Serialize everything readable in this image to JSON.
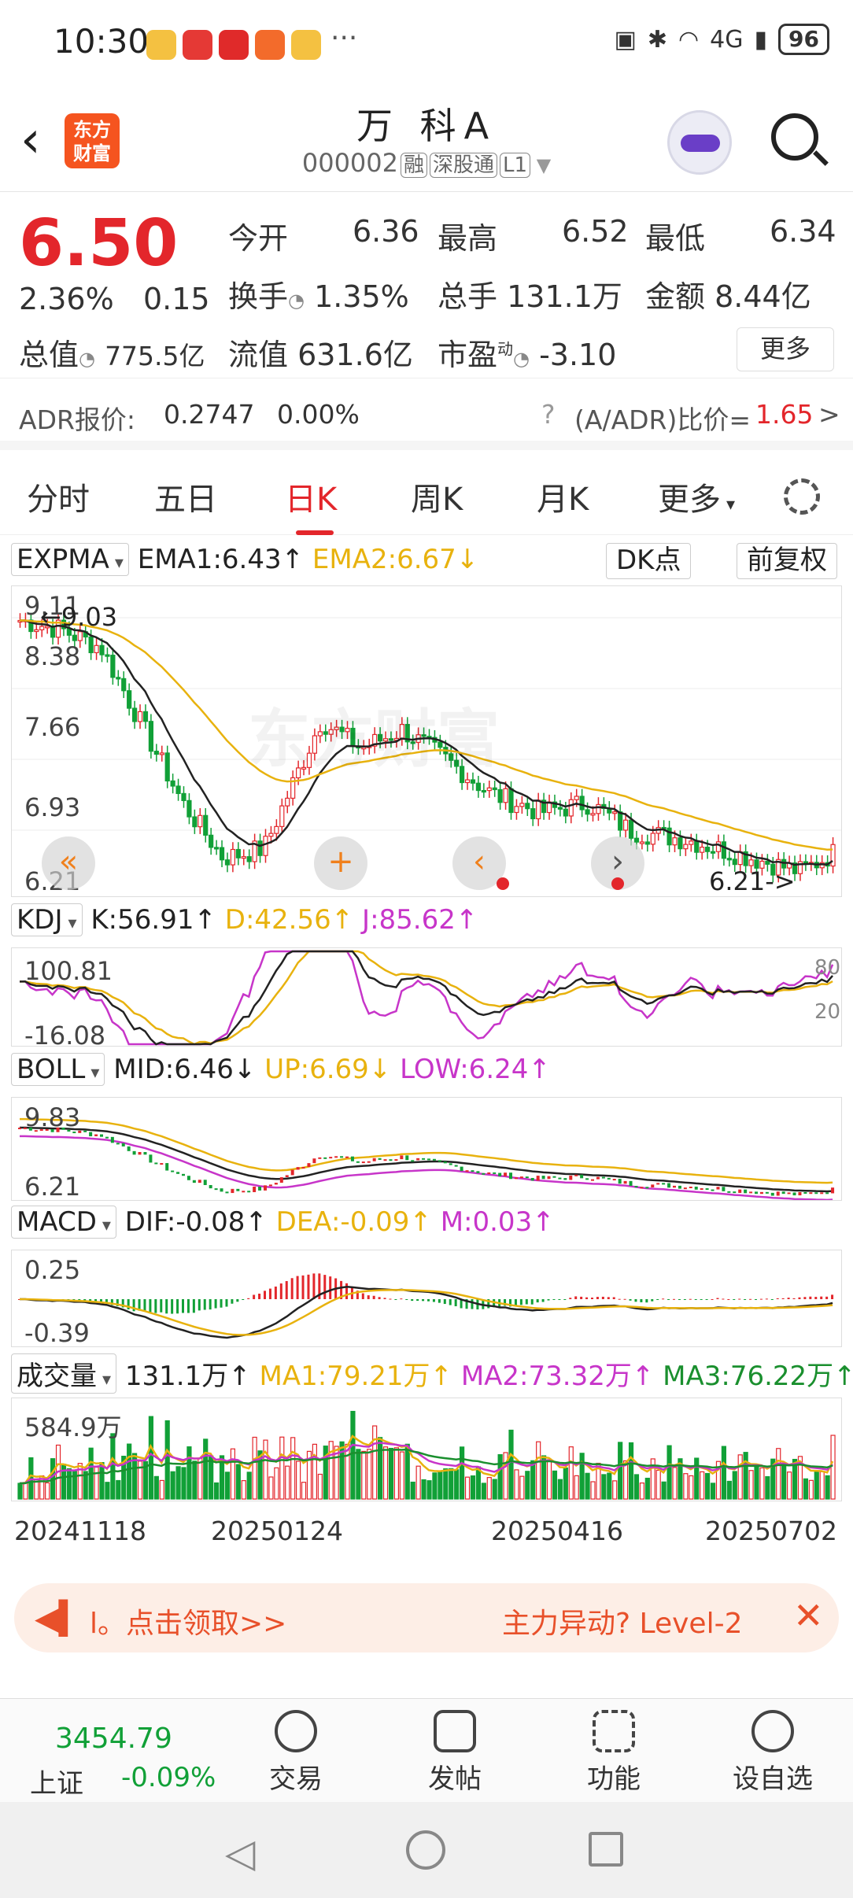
{
  "status": {
    "time": "10:30",
    "dots": "···",
    "signal": "4G",
    "battery": "96"
  },
  "header": {
    "logo": "东方财富",
    "title": "万 科A",
    "code": "000002",
    "tags": [
      "融",
      "深股通",
      "L1"
    ]
  },
  "quote": {
    "price": "6.50",
    "pct": "2.36%",
    "chg": "0.15",
    "open_label": "今开",
    "open": "6.36",
    "high_label": "最高",
    "high": "6.52",
    "low_label": "最低",
    "low": "6.34",
    "turnover_label": "换手",
    "turnover": "1.35%",
    "volume_label": "总手",
    "volume": "131.1万",
    "amount_label": "金额",
    "amount": "8.44亿",
    "mcap_label": "总值",
    "mcap": "775.5亿",
    "float_label": "流值",
    "float": "631.6亿",
    "pe_label": "市盈",
    "pe_sup": "动",
    "pe": "-3.10",
    "more": "更多"
  },
  "adr": {
    "label": "ADR报价:",
    "price": "0.2747",
    "pct": "0.00%",
    "ratio_label": "(A/ADR)比价=",
    "ratio": "1.65",
    "arrow": ">"
  },
  "tabs": [
    "分时",
    "五日",
    "日K",
    "周K",
    "月K",
    "更多"
  ],
  "tabs_active": 2,
  "kline": {
    "ind": "EXPMA",
    "ema1": "EMA1:6.43↑",
    "ema2": "EMA2:6.67↓",
    "dk": "DK点",
    "fq": "前复权",
    "y": [
      "9.11",
      "8.38",
      "7.66",
      "6.93",
      "6.21"
    ],
    "hi_ann": "9.03",
    "lo_ann": "6.21",
    "watermark": "东方财富"
  },
  "kdj": {
    "ind": "KDJ",
    "k": "K:56.91↑",
    "d": "D:42.56↑",
    "j": "J:85.62↑",
    "ytop": "100.81",
    "ybot": "-16.08",
    "r80": "80",
    "r20": "20"
  },
  "boll": {
    "ind": "BOLL",
    "mid": "MID:6.46↓",
    "up": "UP:6.69↓",
    "low": "LOW:6.24↑",
    "ytop": "9.83",
    "ybot": "6.21"
  },
  "macd": {
    "ind": "MACD",
    "dif": "DIF:-0.08↑",
    "dea": "DEA:-0.09↑",
    "m": "M:0.03↑",
    "ytop": "0.25",
    "ybot": "-0.39"
  },
  "vol": {
    "ind": "成交量",
    "v": "131.1万↑",
    "ma1": "MA1:79.21万↑",
    "ma2": "MA2:73.32万↑",
    "ma3": "MA3:76.22万↑",
    "ytop": "584.9万"
  },
  "dates": [
    "20241118",
    "20250124",
    "20250416",
    "20250702"
  ],
  "banner": {
    "left": "l。点击领取>>",
    "right": "主力异动? Level-2"
  },
  "bottom": {
    "index_val": "3454.79",
    "index_name": "上证",
    "index_chg": "-0.09%",
    "items": [
      "交易",
      "发帖",
      "功能",
      "设自选"
    ]
  },
  "colors": {
    "up": "#e3262b",
    "down": "#11a037",
    "accent": "#f5541f",
    "ema2": "#e8b20e",
    "mag": "#c735c9"
  }
}
